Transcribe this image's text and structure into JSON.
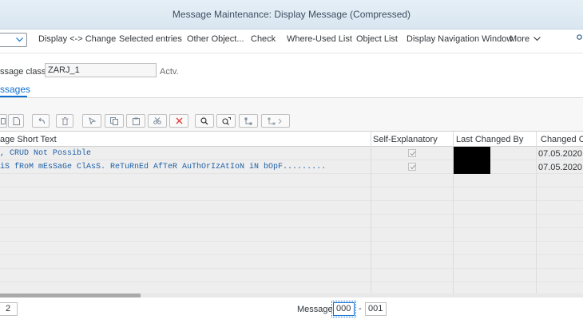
{
  "window": {
    "title": "Message Maintenance: Display Message (Compressed)"
  },
  "toolbar": {
    "items": [
      "Display <-> Change",
      "Selected entries",
      "Other Object...",
      "Check",
      "Where-Used List",
      "Object List",
      "Display Navigation Window"
    ],
    "more_label": "More"
  },
  "header": {
    "message_class_label": "ssage class:",
    "message_class_value": "ZARJ_1",
    "status": "Actv."
  },
  "tab": {
    "label": "ssages"
  },
  "grid": {
    "columns": [
      "age Short Text",
      "Self-Explanatory",
      "Last Changed By",
      "Changed On"
    ],
    "rows": [
      {
        "short_text": ", CRUD Not Possible",
        "self_explanatory": true,
        "last_changed_by": "",
        "changed_on": "07.05.2020"
      },
      {
        "short_text": "iS fRoM mEsSaGe ClAsS. ReTuRnEd AfTeR AuThOrIzAtIoN iN bOpF.........",
        "self_explanatory": true,
        "last_changed_by": "",
        "changed_on": "07.05.2020"
      }
    ]
  },
  "footer": {
    "page_value": "2",
    "message_label": "Message:",
    "message_from": "000",
    "message_dash": "-",
    "message_to": "001"
  },
  "colors": {
    "accent": "#0a6ed1",
    "title_text": "#3d4f63",
    "link_text": "#1f5fa6"
  }
}
